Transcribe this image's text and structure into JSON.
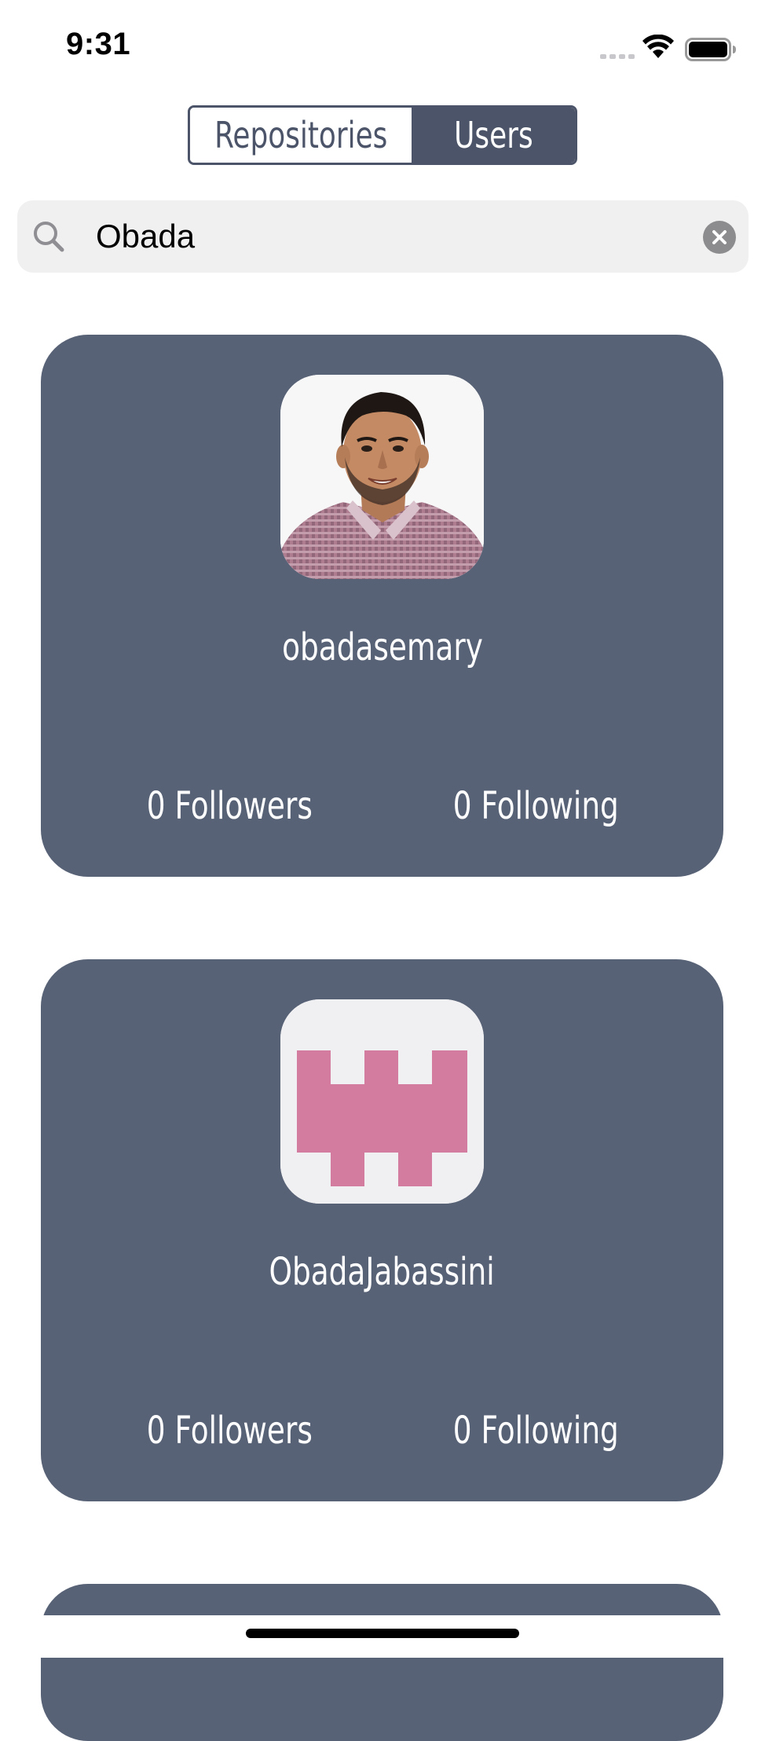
{
  "status_bar": {
    "time": "9:31"
  },
  "segmented_control": {
    "segments": [
      {
        "label": "Repositories",
        "selected": false
      },
      {
        "label": "Users",
        "selected": true
      }
    ],
    "accent_color": "#4b5468"
  },
  "search": {
    "value": "Obada",
    "placeholder": ""
  },
  "users": [
    {
      "username": "obadasemary",
      "followers": "0 Followers",
      "following": "0 Following",
      "avatar": "profile-photo"
    },
    {
      "username": "ObadaJabassini",
      "followers": "0 Followers",
      "following": "0 Following",
      "avatar": "identicon",
      "identicon_color": "#d47ba0"
    }
  ],
  "colors": {
    "card_background": "#586276",
    "search_background": "#f0f0f1"
  }
}
